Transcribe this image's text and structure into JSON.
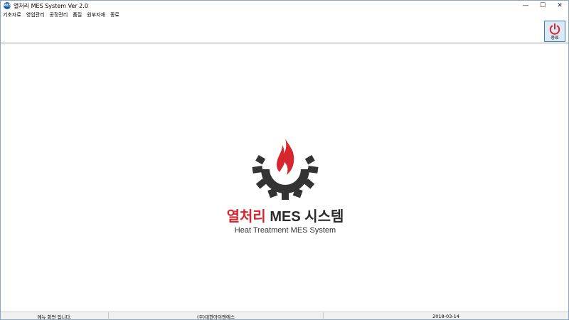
{
  "window": {
    "title": "열처리 MES System Ver 2.0",
    "icon_label": "MES",
    "controls": {
      "minimize": "—",
      "maximize": "☐",
      "close": "✕"
    }
  },
  "menu": {
    "items": [
      {
        "label": "기초자료"
      },
      {
        "label": "영업관리"
      },
      {
        "label": "공정관리"
      },
      {
        "label": "품질"
      },
      {
        "label": "원부자재"
      },
      {
        "label": "종료"
      }
    ]
  },
  "toolbar": {
    "exit_label": "종료",
    "exit_icon": "power-icon"
  },
  "logo": {
    "title_red": "열처리",
    "title_dark": "MES 시스템",
    "subtitle": "Heat Treatment MES System"
  },
  "colors": {
    "brand_red": "#d7262d",
    "gear_dark": "#333333",
    "accent_blue": "#3c7fb1"
  },
  "status": {
    "message": "메뉴 화면 입니다.",
    "company": "(주)대한아이엔에스",
    "date": "2018-03-14"
  }
}
